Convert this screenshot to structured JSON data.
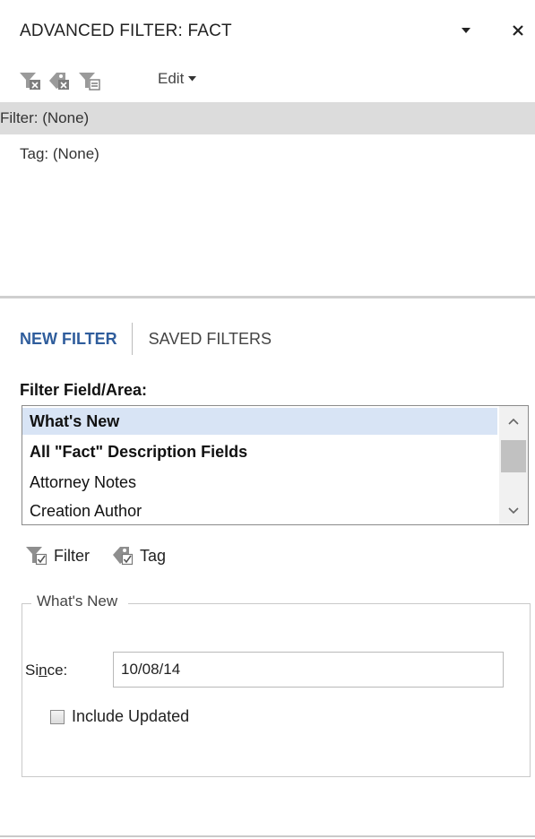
{
  "titlebar": {
    "title": "ADVANCED FILTER:  FACT",
    "dropdown_icon": "triangle-down-icon",
    "close_icon": "close-icon"
  },
  "toolbar": {
    "icons": [
      "clear-filter-icon",
      "clear-tag-icon",
      "filter-list-icon"
    ],
    "edit_label": "Edit"
  },
  "active": {
    "filter_text": "Filter: (None)",
    "tag_text": "Tag: (None)"
  },
  "tabs": {
    "new_filter": "NEW FILTER",
    "saved_filters": "SAVED FILTERS"
  },
  "field": {
    "label": "Filter Field/Area:",
    "items": [
      {
        "label": "What's New",
        "bold": true,
        "selected": true
      },
      {
        "label": "All \"Fact\" Description Fields",
        "bold": true,
        "selected": false
      },
      {
        "label": "Attorney Notes",
        "bold": false,
        "selected": false
      },
      {
        "label": "Creation Author",
        "bold": false,
        "selected": false
      }
    ]
  },
  "actions": {
    "filter_label": "Filter",
    "tag_label": "Tag"
  },
  "whats_new": {
    "legend": "What's New",
    "since_prefix": "Si",
    "since_underlined": "n",
    "since_suffix": "ce:",
    "since_value": "10/08/14",
    "include_updated_label": "Include Updated",
    "include_updated_checked": false
  },
  "colors": {
    "accent": "#2f5d9c",
    "selected_row": "#d8e4f5",
    "active_row": "#dcdcdc"
  }
}
